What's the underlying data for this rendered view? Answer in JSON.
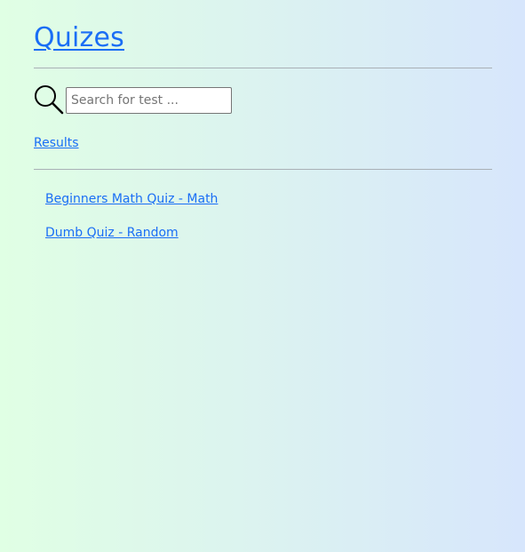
{
  "header": {
    "title": "Quizes"
  },
  "search": {
    "placeholder": "Search for test ...",
    "value": "",
    "icon": "search-icon"
  },
  "nav": {
    "results_label": "Results"
  },
  "quizzes": [
    {
      "label": "Beginners Math Quiz - Math"
    },
    {
      "label": "Dumb Quiz - Random"
    }
  ],
  "colors": {
    "link": "#1a6ef5",
    "gradient_start": "#e0ffe4",
    "gradient_end": "#d7e6fc",
    "separator": "#a9b0b6"
  }
}
